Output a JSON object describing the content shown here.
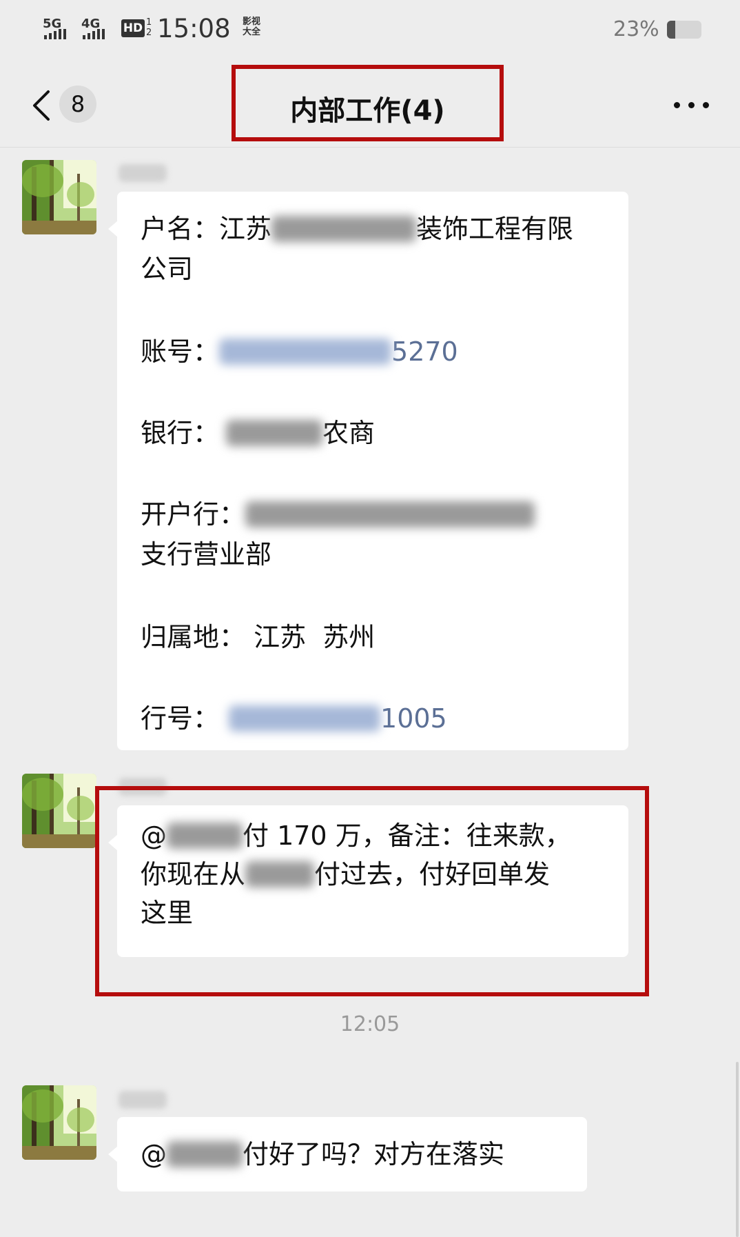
{
  "status_bar": {
    "signal1_label": "5G",
    "signal2_label": "4G",
    "hd_label": "HD",
    "hd_sub": "1\n2",
    "time": "15:08",
    "app_badge": "影视\n大全",
    "battery_percent": "23%",
    "battery_level": 0.23
  },
  "nav": {
    "back_count": "8",
    "title": "内部工作(4)",
    "highlight_color": "#b50d0d"
  },
  "messages": [
    {
      "lines": {
        "name_label": "户名：江苏",
        "name_suffix": "装饰工程有限",
        "name_cont": "公司",
        "account_label": "账号：",
        "account_tail": "5270",
        "bank_label": "银行：",
        "bank_suffix": "农商",
        "branch_label": "开户行：",
        "branch_cont": "支行营业部",
        "location_label": "归属地：",
        "location_value": "江苏  苏州",
        "bank_code_label": "行号：",
        "bank_code_tail": "1005"
      }
    },
    {
      "line1_prefix": "@",
      "line1_suffix": "付 170 万，备注：往来款，",
      "line2_prefix": "你现在从",
      "line2_suffix": "付过去，付好回单发",
      "line3": "这里"
    },
    {
      "prefix": "@",
      "suffix": "付好了吗？对方在落实"
    }
  ],
  "timestamp": "12:05",
  "icons": [
    "back-icon",
    "more-icon",
    "avatar-forest-icon"
  ],
  "colors": {
    "background": "#ededed",
    "bubble": "#ffffff",
    "highlight": "#b50d0d",
    "link_blue": "#5b6f95"
  }
}
